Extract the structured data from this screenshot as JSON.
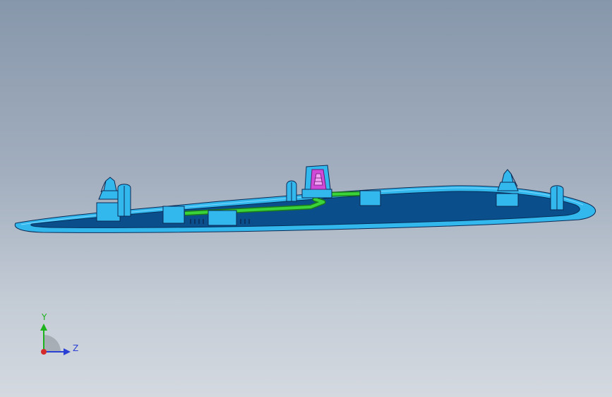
{
  "viewport": {
    "background_top": "#8797ab",
    "background_bottom": "#d4d9e0"
  },
  "model": {
    "colors": {
      "housing_light": "#33b8ee",
      "housing_dark": "#0a4f8c",
      "housing_outline": "#0a2a55",
      "cable": "#3ad43a",
      "connector": "#d04ad8"
    }
  },
  "triad": {
    "y_label": "Y",
    "z_label": "Z",
    "y_color": "#1db31d",
    "z_color": "#2a3fd4",
    "x_color": "#d42a2a"
  }
}
